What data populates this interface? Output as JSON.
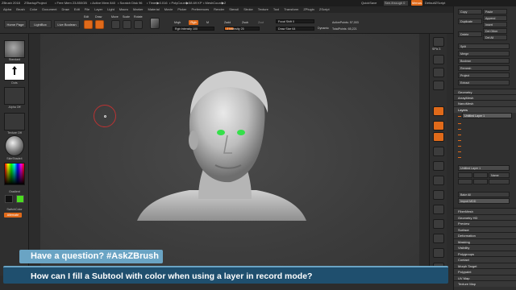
{
  "titlebar": {
    "app": "ZBrush 2018",
    "project": "ZStartupProject",
    "free_mem": "• Free Mem 23.850GB",
    "active_mem": "• Active Mem 840",
    "scratch_disk": "• Scratch Disk 96",
    "timer": "• Timer▶0.016",
    "poly_count": "• PolyCount▶58.69 KP",
    "mesh_count": "• MeshCount▶2",
    "quicksave": "QuickSave",
    "see_through": "See-through  0",
    "menus_btn": "Menus",
    "default_script": "DefaultZScript"
  },
  "menubar": [
    "Alpha",
    "Brush",
    "Color",
    "Document",
    "Draw",
    "Edit",
    "File",
    "Layer",
    "Light",
    "Macro",
    "Marker",
    "Material",
    "Movie",
    "Picker",
    "Preferences",
    "Render",
    "Stencil",
    "Stroke",
    "Texture",
    "Tool",
    "Transform",
    "ZPlugin",
    "ZScript"
  ],
  "shelf": {
    "home_page": "Home Page",
    "lightbox": "LightBox",
    "live_boolean": "Live Boolean",
    "edit": "Edit",
    "draw": "Draw",
    "move": "Move",
    "scale": "Scale",
    "rotate": "Rotate",
    "mrgb": "Mrgb",
    "rgb": "Rgb",
    "m": "M",
    "rgb_intensity": "Rgb Intensity 100",
    "zadd": "Zadd",
    "zsub": "Zsub",
    "zcut": "Zcut",
    "z_intensity": "Z Intensity 25",
    "focal_shift": "Focal Shift 0",
    "draw_size": "Draw Size 64",
    "dynamic": "Dynamic",
    "active_points": "ActivePoints: 57,003",
    "total_points": "TotalPoints: 65,221"
  },
  "lefttray": {
    "standard": "Standard",
    "dots": "Dots",
    "alpha_off": "Alpha Off",
    "texture_off": "Texture Off",
    "material": "SkinShade4",
    "gradient": "Gradient",
    "switch_color": "SwitchColor",
    "alternate": "Alternate"
  },
  "rstrip": {
    "bpr": "BPR",
    "spix": "SPix 3",
    "persp": "Persp",
    "floor": "Floor",
    "local": "Local",
    "lsym": "L.Sym",
    "frame": "Frame",
    "move": "Move",
    "zoom3d": "Zoom3D",
    "rotate": "Rotate",
    "line_fill": "Line Fill",
    "polyf": "PolyF",
    "transp": "Transp",
    "solo": "Solo"
  },
  "rpanel": {
    "copy": "Copy",
    "paste": "Paste",
    "append": "Append",
    "duplicate": "Duplicate",
    "insert": "Insert",
    "del_other": "Del Other",
    "delete": "Delete",
    "del_all": "Del All",
    "split": "Split",
    "merge": "Merge",
    "boolean": "Boolean",
    "remesh": "Remesh",
    "project": "Project",
    "extract": "Extract",
    "geometry": "Geometry",
    "arraymesh": "ArrayMesh",
    "nanomesh": "NanoMesh",
    "layers": "Layers",
    "layer1": "Untitled Layer 1",
    "layer_current": "Untitled Layer 1",
    "name": "Name",
    "bake_all": "Bake All",
    "import_mdd": "Import MDD",
    "section_list": [
      "FiberMesh",
      "Geometry HD",
      "Preview",
      "Surface",
      "Deformation",
      "Masking",
      "Visibility",
      "Polygroups",
      "Contact",
      "Morph Target",
      "Polypaint",
      "UV Map",
      "Texture Map"
    ]
  },
  "caption": {
    "question": "Have a question? ",
    "tag": "#AskZBrush",
    "text": "How can I fill a Subtool with color when using a layer in record mode?"
  },
  "colors": {
    "accent": "#e06a1a",
    "caption_light": "#6aa4c4",
    "caption_dark": "#1f4f6e",
    "eye_green": "#35e04a"
  }
}
